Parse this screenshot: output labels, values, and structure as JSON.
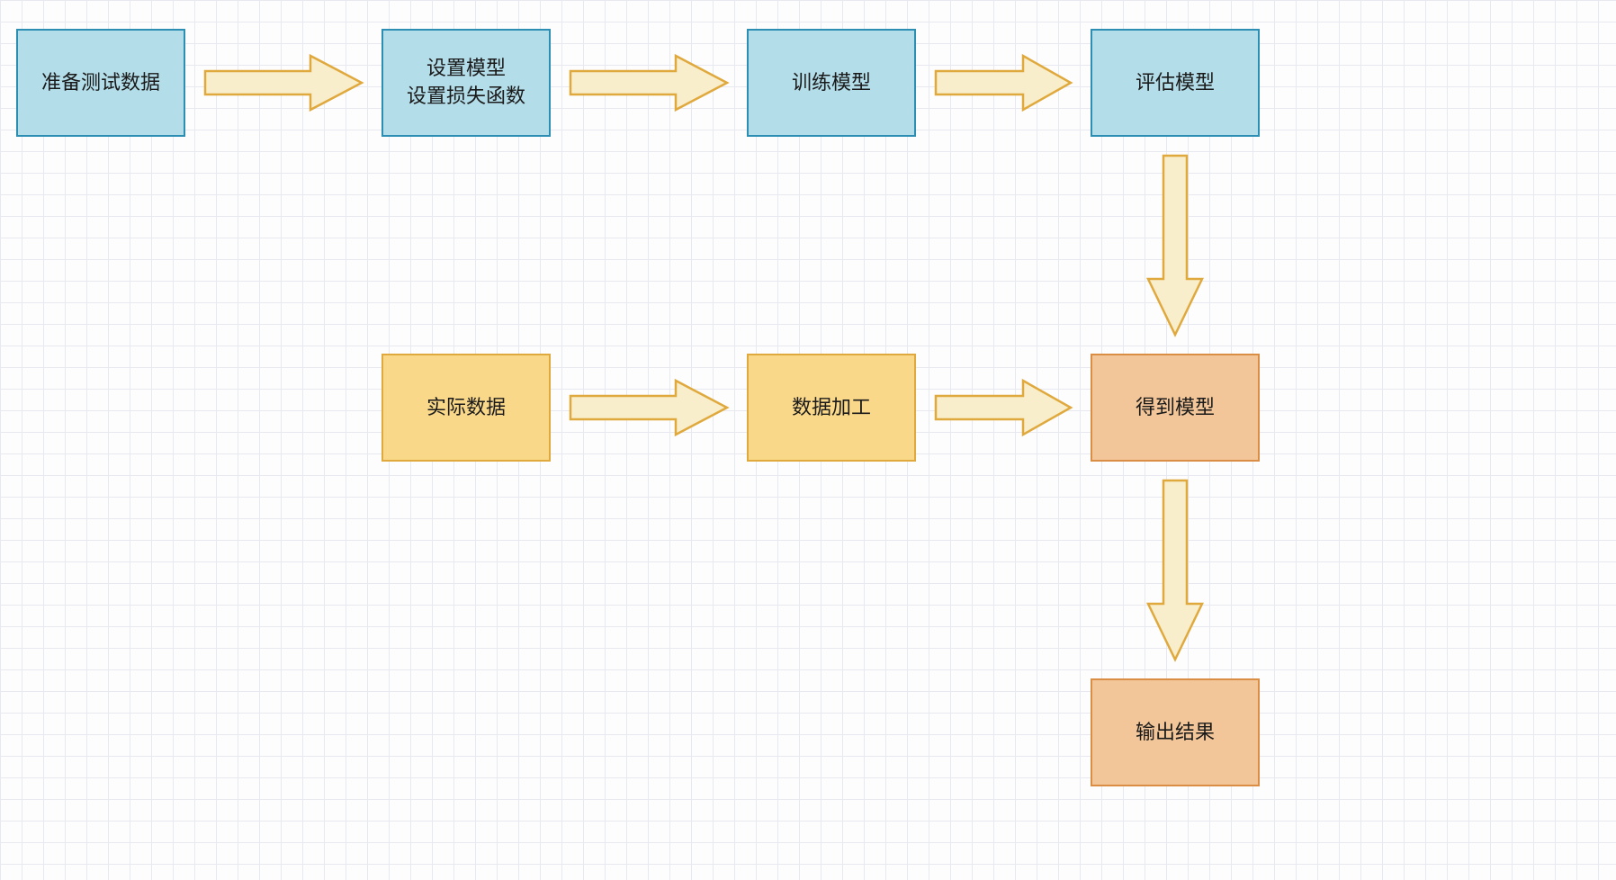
{
  "nodes": {
    "prepare_data": "准备测试数据",
    "set_model": "设置模型\n设置损失函数",
    "train_model": "训练模型",
    "eval_model": "评估模型",
    "real_data": "实际数据",
    "process_data": "数据加工",
    "get_model": "得到模型",
    "output_result": "输出结果"
  },
  "colors": {
    "blue_bg": "#b3dde9",
    "blue_border": "#2d8eb3",
    "yellow_bg": "#f9d88a",
    "yellow_border": "#e0a93e",
    "orange_bg": "#f2c699",
    "orange_border": "#d98d45",
    "arrow_fill": "#f9eecb",
    "arrow_stroke": "#e0a93e"
  }
}
